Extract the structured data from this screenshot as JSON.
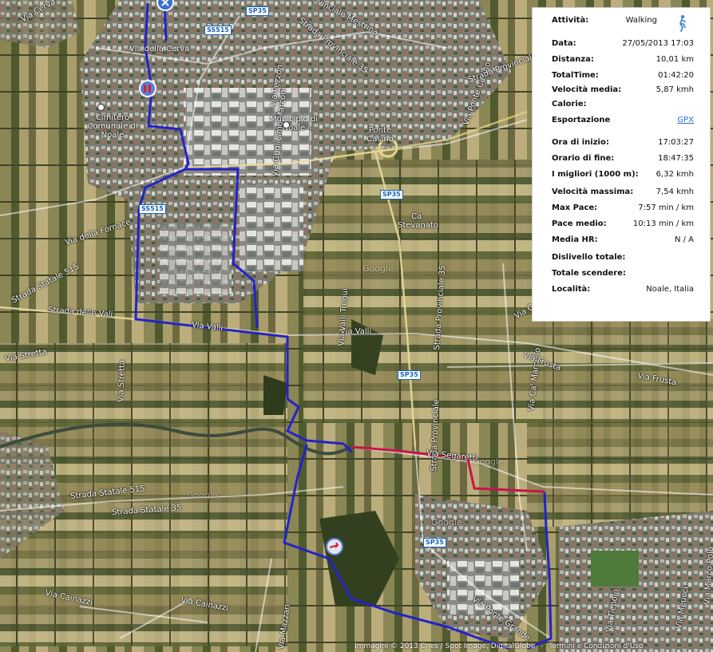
{
  "map": {
    "roads": [
      {
        "id": "via-cerva",
        "text": "Via Cerva"
      },
      {
        "id": "via-della-cerva",
        "text": "Via della Cerva"
      },
      {
        "id": "strada-prov-mestrina",
        "text": "Strada Provinciale Mestrina"
      },
      {
        "id": "strada-prov-35-top",
        "text": "Strada Provinciale 35"
      },
      {
        "id": "via-pezzon",
        "text": "Via Pezzon"
      },
      {
        "id": "via-guglielmo-marconi",
        "text": "Via Guglielmo Marconi"
      },
      {
        "id": "via-ponte-casino",
        "text": "Via Ponte Casino"
      },
      {
        "id": "strada-provinciale-mid",
        "text": "Strada Provinciale"
      },
      {
        "id": "via-della-fornace",
        "text": "Via della Fornace"
      },
      {
        "id": "strada-statale-515-w",
        "text": "Strada Statale 515"
      },
      {
        "id": "strada-delle-vali",
        "text": "Strada delle Vali"
      },
      {
        "id": "via-valli-w",
        "text": "Via Valli"
      },
      {
        "id": "via-valli-e",
        "text": "Via Valli"
      },
      {
        "id": "via-ca-marcello",
        "text": "Via Ca' Marcello"
      },
      {
        "id": "via-frusta",
        "text": "Via Frusta"
      },
      {
        "id": "via-frusta-e",
        "text": "Via Frusta"
      },
      {
        "id": "via-stretta",
        "text": "Via Stretta"
      },
      {
        "id": "via-stretta-v",
        "text": "Via Stretta"
      },
      {
        "id": "strada-provinciale-v",
        "text": "Strada Provinciale"
      },
      {
        "id": "strada-provinciale-sp",
        "text": "Strada Provinciale 35"
      },
      {
        "id": "via-segaretti",
        "text": "Via Segaretti"
      },
      {
        "id": "strada-statale-35",
        "text": "Strada Statale 35"
      },
      {
        "id": "strada-statale-515-sw",
        "text": "Strada Statale 515"
      },
      {
        "id": "via-mazzari",
        "text": "Via Mazzari"
      },
      {
        "id": "via-cainazzi",
        "text": "Via Cainazzi"
      },
      {
        "id": "via-cainazzi-2",
        "text": "Via Cainazzi"
      },
      {
        "id": "via-ponte-grande",
        "text": "Via Ponte Grande"
      },
      {
        "id": "via-marco-polo",
        "text": "Via Marco Polo"
      },
      {
        "id": "via-meucci",
        "text": "Via Meucci"
      },
      {
        "id": "via-tiepolo",
        "text": "Via Tiepolo"
      },
      {
        "id": "via-valli-tregui",
        "text": "Via Valli Tregui"
      },
      {
        "id": "via-ca-marcello-top",
        "text": "Via Ca' Marcello"
      }
    ],
    "places": [
      {
        "id": "cimitero",
        "text": "Cimitero Comunale di Noale"
      },
      {
        "id": "municipio",
        "text": "Municipio di Noale"
      },
      {
        "id": "ponte-casino",
        "text": "Ponte Casino"
      },
      {
        "id": "ca-stevanato",
        "text": "Ca' Stevanato"
      }
    ],
    "shields": [
      {
        "id": "sp35-top",
        "text": "SP35"
      },
      {
        "id": "ss515-top",
        "text": "SS515"
      },
      {
        "id": "ss515-mid",
        "text": "SS515"
      },
      {
        "id": "sp35-mid",
        "text": "SP35"
      },
      {
        "id": "sp35-low",
        "text": "SP35"
      },
      {
        "id": "sp35-bottom",
        "text": "SP35"
      }
    ],
    "watermarks": [
      "Google",
      "Google",
      "Google",
      "Google"
    ],
    "copyright": {
      "imagery": "Immagini © 2013 Cnes / Spot Image, DigitalGlobe",
      "sep": "-",
      "terms": "Termini e Condizioni d'Uso"
    },
    "route_colors": {
      "walk": "#2323c9",
      "fast": "#c8144a"
    }
  },
  "info": {
    "activity": {
      "label": "Attività:",
      "value": "Walking",
      "icon": "walking-person-icon"
    },
    "rows": [
      {
        "label": "Data:",
        "value": "27/05/2013 17:03"
      },
      {
        "label": "Distanza:",
        "value": "10,01 km"
      },
      {
        "label": "TotalTime:",
        "value": "01:42:20"
      },
      {
        "label": "Velocità media:",
        "value": "5,87 kmh"
      },
      {
        "label": "Calorie:",
        "value": ""
      },
      {
        "label": "Esportazione",
        "value": "GPX"
      },
      {
        "label": "Ora di inizio:",
        "value": "17:03:27"
      },
      {
        "label": "Orario di fine:",
        "value": "18:47:35"
      },
      {
        "label": "I migliori (1000 m):",
        "value": "6,32 kmh"
      },
      {
        "label": "Velocità massima:",
        "value": "7,54 kmh"
      },
      {
        "label": "Max Pace:",
        "value": "7:57 min / km"
      },
      {
        "label": "Pace medio:",
        "value": "10:13 min / km"
      },
      {
        "label": "Media HR:",
        "value": "N / A"
      },
      {
        "label": "Dislivello totale:",
        "value": ""
      },
      {
        "label": "Totale scendere:",
        "value": ""
      },
      {
        "label": "Località:",
        "value": "Noale, Italia"
      }
    ]
  }
}
